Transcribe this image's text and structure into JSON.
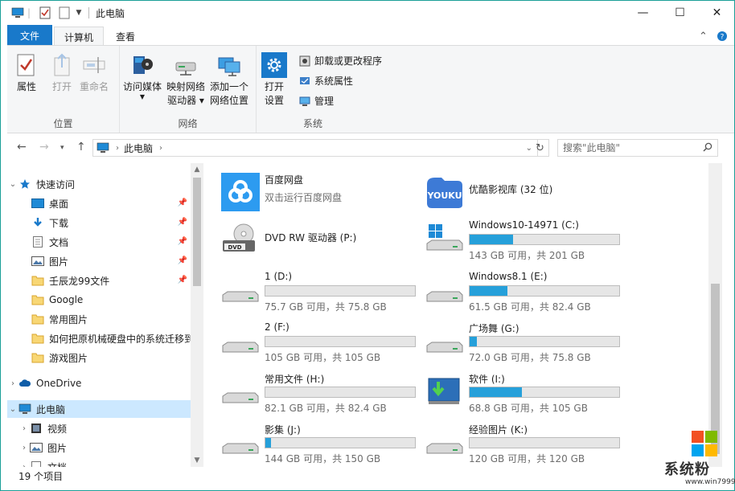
{
  "title_bar": {
    "title": "此电脑",
    "minimize": "—",
    "maximize": "☐",
    "close": "✕"
  },
  "tabs": {
    "file": "文件",
    "computer": "计算机",
    "view": "查看"
  },
  "ribbon": {
    "location": {
      "label": "位置",
      "properties": "属性",
      "open": "打开",
      "rename": "重命名"
    },
    "network": {
      "label": "网络",
      "media_line1": "访问媒体",
      "map_line1": "映射网络",
      "map_line2": "驱动器 ▾",
      "add_line1": "添加一个",
      "add_line2": "网络位置"
    },
    "system": {
      "label": "系统",
      "settings_line1": "打开",
      "settings_line2": "设置",
      "uninstall": "卸载或更改程序",
      "sysprops": "系统属性",
      "manage": "管理"
    }
  },
  "address": {
    "path": "此电脑",
    "search_placeholder": "搜索\"此电脑\""
  },
  "nav": {
    "quick_access": "快速访问",
    "items": [
      {
        "label": "桌面",
        "pinned": true
      },
      {
        "label": "下载",
        "pinned": true
      },
      {
        "label": "文档",
        "pinned": true
      },
      {
        "label": "图片",
        "pinned": true
      },
      {
        "label": "壬辰龙99文件",
        "pinned": true
      },
      {
        "label": "Google",
        "pinned": false
      },
      {
        "label": "常用图片",
        "pinned": false
      },
      {
        "label": "如何把原机械硬盘中的系统迁移到",
        "pinned": false
      },
      {
        "label": "游戏图片",
        "pinned": false
      }
    ],
    "onedrive": "OneDrive",
    "this_pc": "此电脑",
    "pc_children": [
      "视频",
      "图片",
      "文档"
    ]
  },
  "content": {
    "apps": [
      {
        "name": "百度网盘",
        "sub": "双击运行百度网盘"
      },
      {
        "name": "优酷影视库 (32 位)",
        "sub": ""
      }
    ],
    "drives": [
      {
        "name": "DVD RW 驱动器 (P:)",
        "free": "",
        "used": null
      },
      {
        "name": "Windows10-14971 (C:)",
        "free": "143 GB 可用，共 201 GB",
        "used": 0.29
      },
      {
        "name": "1 (D:)",
        "free": "75.7 GB 可用，共 75.8 GB",
        "used": 0.0
      },
      {
        "name": "Windows8.1 (E:)",
        "free": "61.5 GB 可用，共 82.4 GB",
        "used": 0.25
      },
      {
        "name": "2 (F:)",
        "free": "105 GB 可用，共 105 GB",
        "used": 0.0
      },
      {
        "name": "广场舞 (G:)",
        "free": "72.0 GB 可用，共 75.8 GB",
        "used": 0.05
      },
      {
        "name": "常用文件 (H:)",
        "free": "82.1 GB 可用，共 82.4 GB",
        "used": 0.0
      },
      {
        "name": "软件 (I:)",
        "free": "68.8 GB 可用，共 105 GB",
        "used": 0.35
      },
      {
        "name": "影集 (J:)",
        "free": "144 GB 可用，共 150 GB",
        "used": 0.04
      },
      {
        "name": "经验图片 (K:)",
        "free": "120 GB 可用，共 120 GB",
        "used": 0.0
      }
    ]
  },
  "status": {
    "count": "19 个项目"
  },
  "watermark": {
    "brand": "系统粉",
    "url": "www.win7999.com"
  },
  "colors": {
    "accent": "#1979ca",
    "bar_fill": "#26a0da",
    "selected": "#cce8ff"
  }
}
